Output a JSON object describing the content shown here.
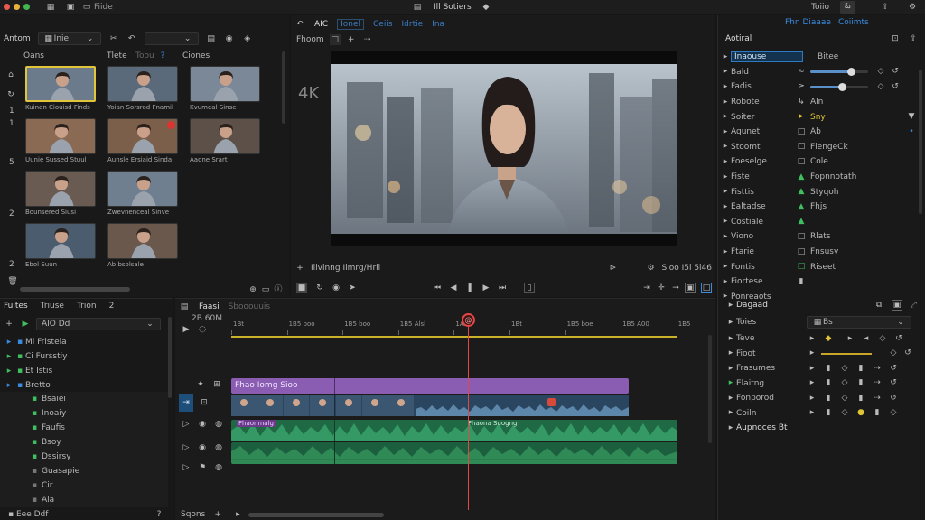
{
  "titlebar": {
    "file_menu": "Fiide",
    "title": "Ill Sotiers",
    "right_tab1": "Toiio",
    "right_tab2": "ఓ"
  },
  "media": {
    "header_label": "Antom",
    "header_dropdown": "Inie",
    "tabs": [
      "Oans",
      "Tlete",
      "Toou",
      "Ciones"
    ],
    "side_numbers": [
      "1",
      "1",
      "5",
      "2",
      "2"
    ],
    "clips": [
      {
        "label": "Kuinen Ciouisd Finds"
      },
      {
        "label": "Yoian Sorsrod Fnamil"
      },
      {
        "label": "Kvumeal Sinse"
      },
      {
        "label": "Uunie Sussed Stuul"
      },
      {
        "label": "Aunsle Ersiaid Sinda"
      },
      {
        "label": "Aaone Srart"
      },
      {
        "label": "Bounsered Siusi"
      },
      {
        "label": "Zwevnenceal Sinve"
      },
      {
        "label": ""
      },
      {
        "label": "Ebol Suun"
      },
      {
        "label": "Ab bsolsale"
      },
      {
        "label": ""
      }
    ]
  },
  "viewer": {
    "tab_active": "AIC",
    "tabs": [
      "Ionel",
      "Ceiis",
      "Idrtie",
      "Ina"
    ],
    "sub_label": "Fhoom",
    "badge": "4K",
    "status_left": "Iilvinng Ilmrg/Hrll",
    "status_right": "Sloo  I5l  5l46",
    "subject": "woman in a grey denim shirt, city bokeh background"
  },
  "inspector": {
    "title": "Aotiral",
    "tab1": "Fhn Diaaae",
    "tab2": "Coiimts",
    "rows": [
      {
        "name": "Inaouse",
        "value": "Bitee",
        "selected": true
      },
      {
        "name": "Bald",
        "value": ""
      },
      {
        "name": "Fadis",
        "value": ""
      },
      {
        "name": "Robote",
        "value": "Aln"
      },
      {
        "name": "Soiter",
        "value": "Sny"
      },
      {
        "name": "Aqunet",
        "value": "Ab"
      },
      {
        "name": "Stoomt",
        "value": "FlengeCk"
      },
      {
        "name": "Foeselge",
        "value": "Cole"
      },
      {
        "name": "Fiste",
        "value": "Fopnnotath"
      },
      {
        "name": "Fisttis",
        "value": "Styqoh"
      },
      {
        "name": "Ealtadse",
        "value": "Fhjs"
      },
      {
        "name": "Costiale",
        "value": ""
      },
      {
        "name": "Viono",
        "value": "Rlats"
      },
      {
        "name": "Ftarie",
        "value": "Fnsusy"
      },
      {
        "name": "Fontis",
        "value": "Riseet"
      },
      {
        "name": "Fiortese",
        "value": ""
      },
      {
        "name": "Ponreaots",
        "value": ""
      }
    ],
    "section2_title": "Dagaad",
    "section2_dropdown_label": "Toies",
    "section2_dropdown_value": "Bs",
    "section2_rows": [
      "Teve",
      "Fioot",
      "Frasumes",
      "Elaitng",
      "Fonporod",
      "Coiln"
    ],
    "section2_badge": "1",
    "footer": "Aupnoces Bt"
  },
  "timeline": {
    "left_tabs": [
      "Fuites",
      "Triuse",
      "Trion",
      "2"
    ],
    "left_dropdown": "AIO  Dd",
    "tracks_top": [
      {
        "name": "Mi Fristeia",
        "color": "#3a8be0"
      },
      {
        "name": "Ci Fursstiy",
        "color": "#3fbf5f"
      },
      {
        "name": "Et Istis",
        "color": "#3fbf5f"
      },
      {
        "name": "Bretto",
        "color": "#3a8be0"
      }
    ],
    "tracks_bottom": [
      "Bsaiei",
      "Inoaiy",
      "Faufis",
      "Bsoy",
      "Dssirsy",
      "Guasapie",
      "Cir",
      "Aia"
    ],
    "bottom_left": "Eee Ddf",
    "tabs": [
      "Faasi",
      "Sbooouuis"
    ],
    "timecode": "2B  60M",
    "ruler": [
      "1Bt",
      "1B5 boo",
      "1B5 boo",
      "1B5 Alsl",
      "1A5",
      "1Bt",
      "1B5 boe",
      "1B5 A00",
      "1B5"
    ],
    "video_title": "Fhao Iomg Sioo",
    "audio_label1": "Fhaonmalg",
    "audio_label2": "Fhaona Suogng",
    "footer_label": "Sqons",
    "marker": "@"
  }
}
